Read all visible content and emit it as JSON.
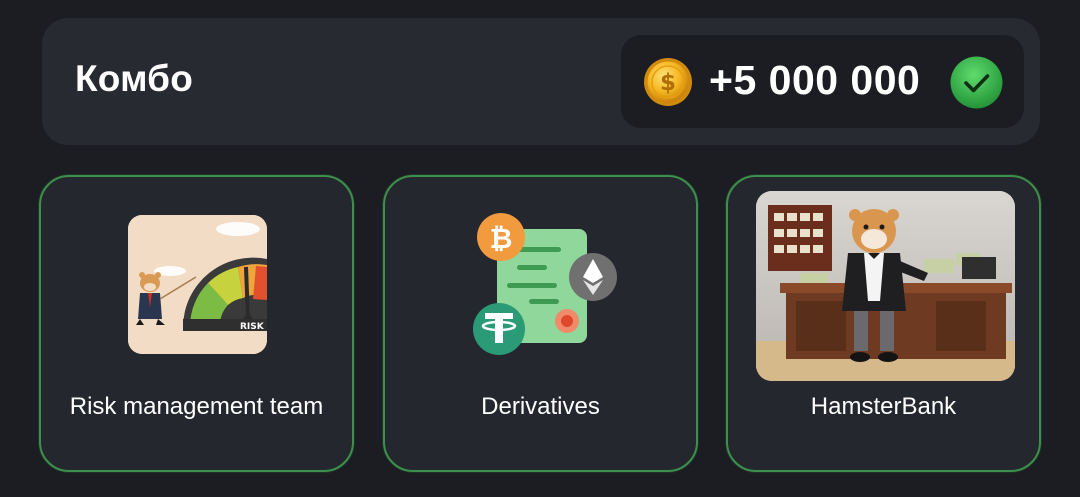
{
  "header": {
    "title": "Комбо",
    "reward_amount": "+5 000 000",
    "coin_icon": "gold-coin-icon",
    "status_icon": "green-check-icon"
  },
  "cards": [
    {
      "label": "Risk management team",
      "image": "hamster-risk-gauge-illustration"
    },
    {
      "label": "Derivatives",
      "image": "crypto-document-bitcoin-ethereum-tether-illustration"
    },
    {
      "label": "HamsterBank",
      "image": "hamster-banker-at-desk-illustration"
    }
  ],
  "colors": {
    "background": "#1b1d22",
    "panel": "#272a30",
    "card_border": "#3d8f4c",
    "check_green": "#2fb14a",
    "coin_gold": "#f1b422"
  }
}
